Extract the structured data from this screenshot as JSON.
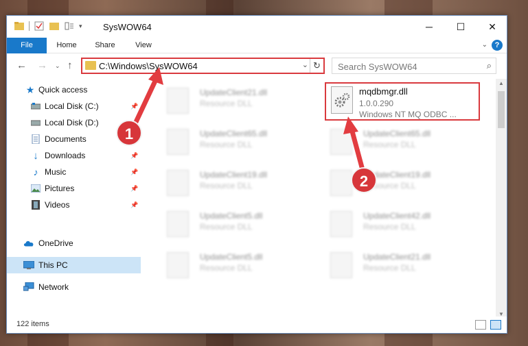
{
  "window": {
    "title": "SysWOW64"
  },
  "ribbon": {
    "tabs": [
      "File",
      "Home",
      "Share",
      "View"
    ],
    "help": "?"
  },
  "address": {
    "path": "C:\\Windows\\SysWOW64"
  },
  "search": {
    "placeholder": "Search SysWOW64"
  },
  "sidebar": {
    "items": [
      {
        "label": "Quick access",
        "icon": "star-icon"
      },
      {
        "label": "Local Disk (C:)",
        "icon": "drive-icon"
      },
      {
        "label": "Local Disk (D:)",
        "icon": "drive-icon"
      },
      {
        "label": "Documents",
        "icon": "document-icon"
      },
      {
        "label": "Downloads",
        "icon": "download-icon"
      },
      {
        "label": "Music",
        "icon": "music-icon"
      },
      {
        "label": "Pictures",
        "icon": "picture-icon"
      },
      {
        "label": "Videos",
        "icon": "video-icon"
      },
      {
        "label": "OneDrive",
        "icon": "cloud-icon"
      },
      {
        "label": "This PC",
        "icon": "computer-icon"
      },
      {
        "label": "Network",
        "icon": "network-icon"
      }
    ]
  },
  "files": [
    {
      "name": "UpdateClient21.dll",
      "type": "Resource DLL"
    },
    {
      "name": "UpdateClient65.dll",
      "type": "Resource DLL"
    },
    {
      "name": "UpdateClient65.dll",
      "type": "Resource DLL"
    },
    {
      "name": "UpdateClient19.dll",
      "type": "Resource DLL"
    },
    {
      "name": "UpdateClient19.dll",
      "type": "Resource DLL"
    },
    {
      "name": "UpdateClient5.dll",
      "type": "Resource DLL"
    },
    {
      "name": "UpdateClient42.dll",
      "type": "Resource DLL"
    },
    {
      "name": "UpdateClient5.dll",
      "type": "Resource DLL"
    },
    {
      "name": "UpdateClient21.dll",
      "type": "Resource DLL"
    }
  ],
  "highlighted_file": {
    "name": "mqdbmgr.dll",
    "version": "1.0.0.290",
    "description": "Windows NT MQ ODBC ..."
  },
  "status": {
    "items": "122 items"
  },
  "annotations": {
    "badge1": "1",
    "badge2": "2"
  },
  "colors": {
    "accent": "#1979ca",
    "highlight": "#d9393d",
    "selected": "#cce4f7"
  }
}
